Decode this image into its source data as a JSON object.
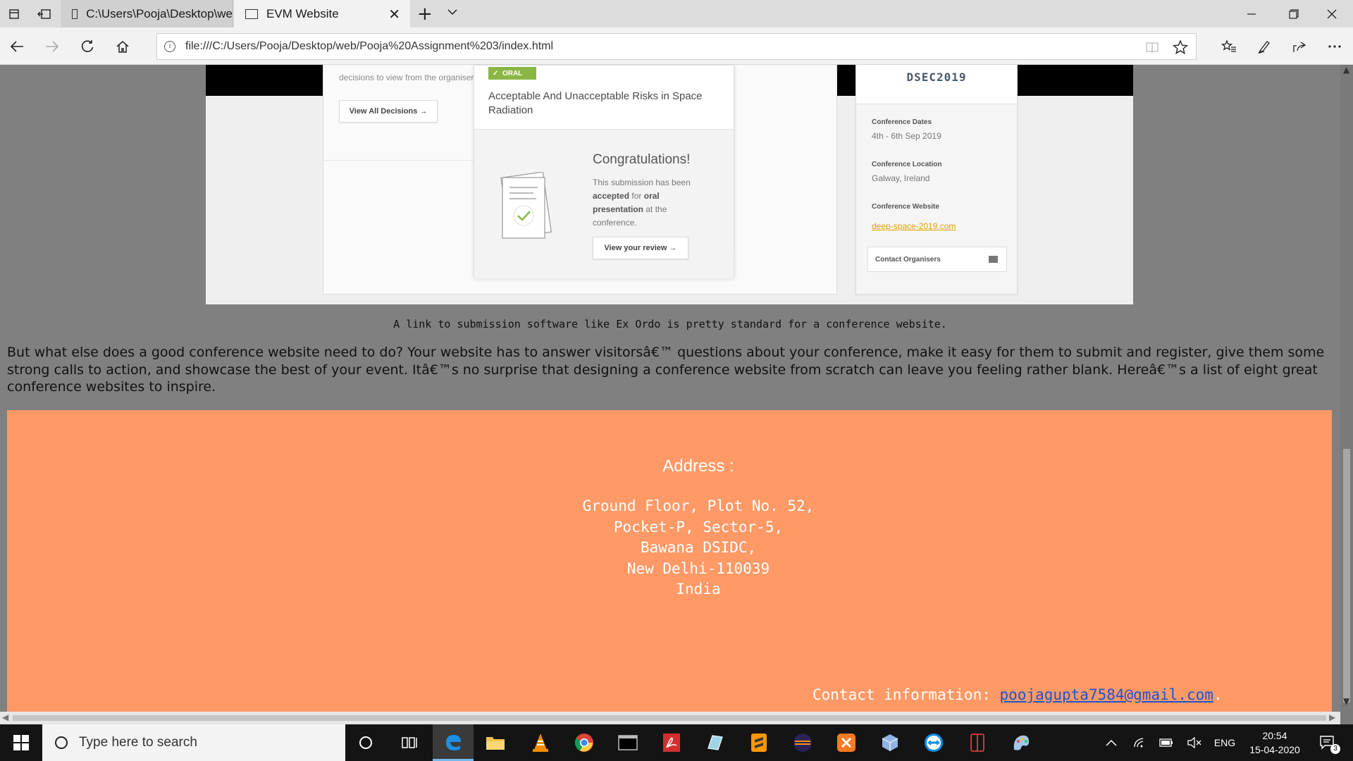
{
  "browser": {
    "tabs": [
      {
        "label": "C:\\Users\\Pooja\\Desktop\\we",
        "active": false
      },
      {
        "label": "EVM Website",
        "active": true
      }
    ],
    "url": "file:///C:/Users/Pooja/Desktop/web/Pooja%20Assignment%203/index.html"
  },
  "hero_image": {
    "left_text": "decisions to view from the organisers.",
    "view_all_decisions": "View All Decisions",
    "badge": "ORAL",
    "card_title": "Acceptable And Unacceptable Risks in Space Radiation",
    "congrats_title": "Congratulations!",
    "congrats_pre": "This submission has been",
    "congrats_accepted": "accepted",
    "congrats_for": "for",
    "congrats_oral": "oral presentation",
    "congrats_post": "at the conference.",
    "view_review": "View your review",
    "side_title": "DSEC2019",
    "dates_label": "Conference Dates",
    "dates_value": "4th - 6th Sep 2019",
    "location_label": "Conference Location",
    "location_value": "Galway, Ireland",
    "website_label": "Conference Website",
    "website_value": "deep-space-2019.com",
    "contact_organisers": "Contact Organisers"
  },
  "caption": "A link to submission software like Ex Ordo is pretty standard for a conference website.",
  "paragraph": "But what else does a good conference website need to do? Your website has to answer visitorsâ€™ questions about your conference, make it easy for them to submit and register, give them some strong calls to action, and showcase the best of your event. Itâ€™s no surprise that designing a conference website from scratch can leave you feeling rather blank. Hereâ€™s a list of eight great conference websites to inspire.",
  "footer": {
    "address_title": "Address :",
    "address_lines": [
      "Ground Floor, Plot No. 52,",
      "Pocket-P, Sector-5,",
      "Bawana DSIDC,",
      "New Delhi-110039",
      "India"
    ],
    "contact_label": "Contact information: ",
    "contact_email": "poojagupta7584@gmail.com",
    "contact_suffix": "."
  },
  "taskbar": {
    "search_placeholder": "Type here to search",
    "language": "ENG",
    "time": "20:54",
    "date": "15-04-2020",
    "notification_count": "3"
  },
  "colors": {
    "footer_bg": "#ff9966",
    "page_bg": "#808080",
    "link": "#1a55d0",
    "badge": "#8bb646"
  }
}
